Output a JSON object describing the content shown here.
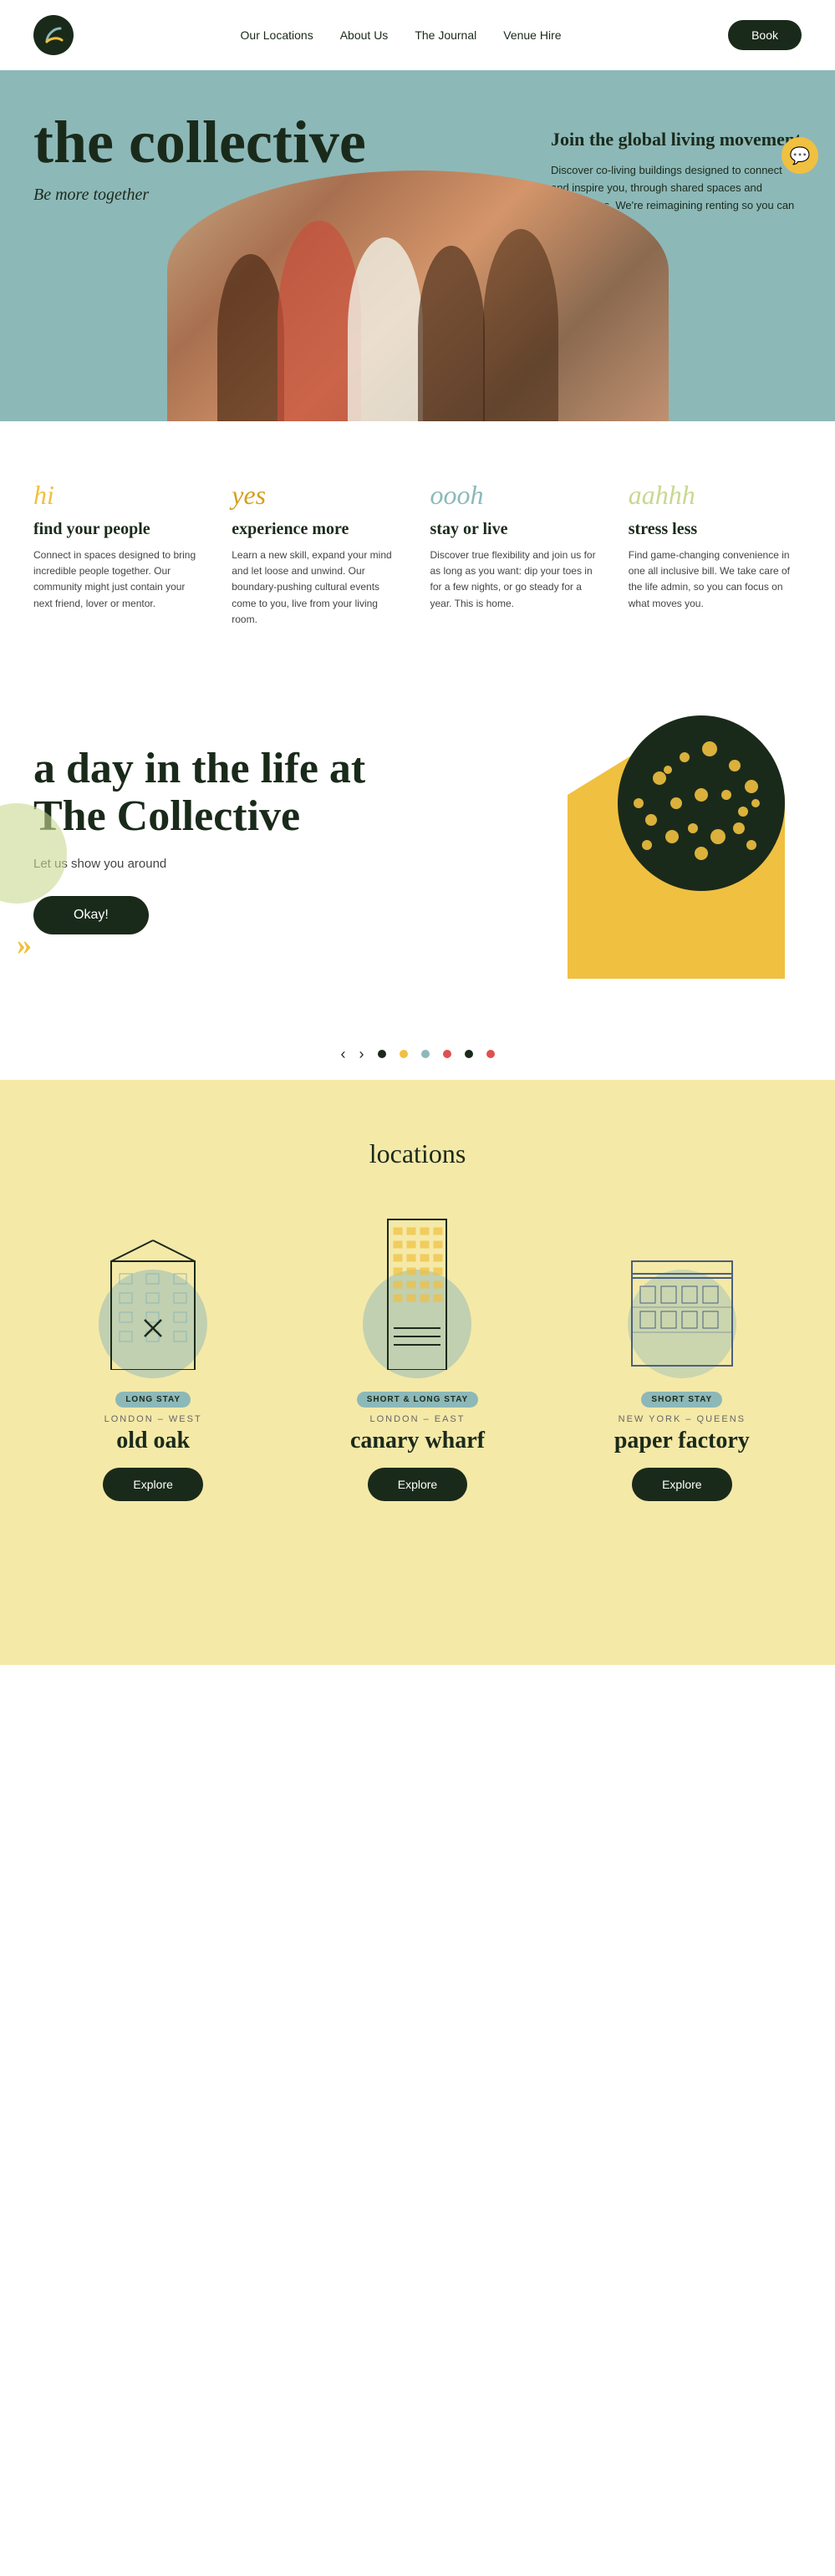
{
  "nav": {
    "links": [
      {
        "label": "Our Locations",
        "id": "our-locations"
      },
      {
        "label": "About Us",
        "id": "about-us"
      },
      {
        "label": "The Journal",
        "id": "the-journal"
      },
      {
        "label": "Venue Hire",
        "id": "venue-hire"
      }
    ],
    "book_label": "Book"
  },
  "hero": {
    "title": "the collective",
    "subtitle": "Be more together",
    "tagline": "Join the global living movement",
    "description": "Discover co-living buildings designed to connect and inspire you, through shared spaces and experiences. We're reimagining renting so you can live your best life."
  },
  "features": [
    {
      "word": "hi",
      "word_class": "hi",
      "title": "find your people",
      "description": "Connect in spaces designed to bring incredible people together. Our community might just contain your next friend, lover or mentor."
    },
    {
      "word": "yes",
      "word_class": "yes",
      "title": "experience more",
      "description": "Learn a new skill, expand your mind and let loose and unwind. Our boundary-pushing cultural events come to you, live from your living room."
    },
    {
      "word": "oooh",
      "word_class": "oooh",
      "title": "stay or live",
      "description": "Discover true flexibility and join us for as long as you want: dip your toes in for a few nights, or go steady for a year. This is home."
    },
    {
      "word": "aahhh",
      "word_class": "aahhh",
      "title": "stress less",
      "description": "Find game-changing convenience in one all inclusive bill. We take care of the life admin, so you can focus on what moves you."
    }
  ],
  "day_section": {
    "title": "a day in the life at The Collective",
    "subtitle": "Let us show you around",
    "cta_label": "Okay!"
  },
  "carousel": {
    "dots": [
      {
        "color": "#1a2a1a",
        "active": true
      },
      {
        "color": "#f0c040",
        "active": false
      },
      {
        "color": "#8db8b8",
        "active": false
      },
      {
        "color": "#e05050",
        "active": false
      },
      {
        "color": "#1a2a1a",
        "active": false
      },
      {
        "color": "#e05050",
        "active": false
      }
    ]
  },
  "locations": {
    "title": "locations",
    "cards": [
      {
        "badge": "LONG STAY",
        "region": "LONDON – WEST",
        "name": "old oak",
        "cta": "Explore",
        "bg_color": "#8db8b8"
      },
      {
        "badge": "SHORT & LONG STAY",
        "region": "LONDON – EAST",
        "name": "canary wharf",
        "cta": "Explore",
        "bg_color": "#8db8b8"
      },
      {
        "badge": "SHORT STAY",
        "region": "NEW YORK – QUEENS",
        "name": "paper factory",
        "cta": "Explore",
        "bg_color": "#8db8b8"
      }
    ]
  }
}
